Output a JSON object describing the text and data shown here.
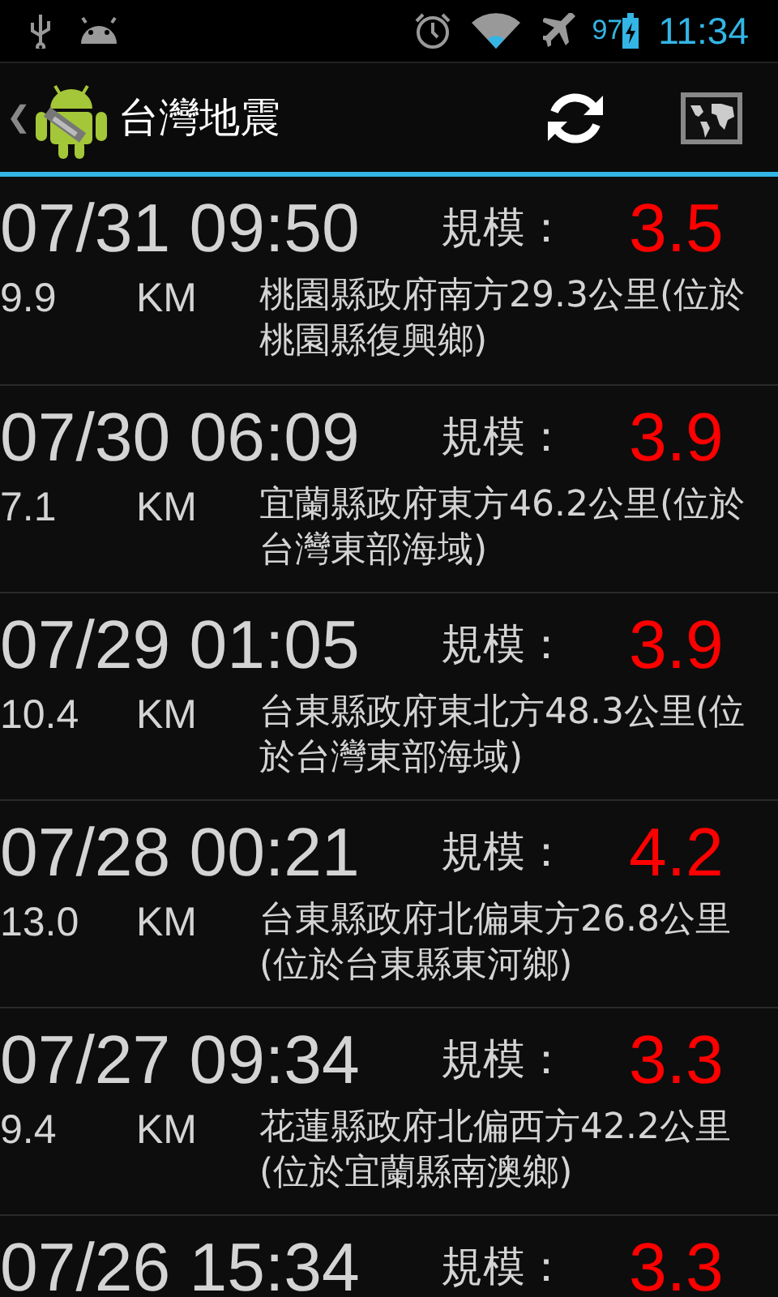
{
  "status_bar": {
    "battery_text": "97",
    "time": "11:34"
  },
  "action_bar": {
    "back": "❮",
    "title": "台灣地震"
  },
  "quakes": [
    {
      "time": "07/31 09:50",
      "magnitude_label": "規模：",
      "magnitude": "3.5",
      "depth": "9.9",
      "unit": "KM",
      "location": "桃園縣政府南方29.3公里(位於桃園縣復興鄉)"
    },
    {
      "time": "07/30 06:09",
      "magnitude_label": "規模：",
      "magnitude": "3.9",
      "depth": "7.1",
      "unit": "KM",
      "location": "宜蘭縣政府東方46.2公里(位於台灣東部海域)"
    },
    {
      "time": "07/29 01:05",
      "magnitude_label": "規模：",
      "magnitude": "3.9",
      "depth": "10.4",
      "unit": "KM",
      "location": "台東縣政府東北方48.3公里(位於台灣東部海域)"
    },
    {
      "time": "07/28 00:21",
      "magnitude_label": "規模：",
      "magnitude": "4.2",
      "depth": "13.0",
      "unit": "KM",
      "location": "台東縣政府北偏東方26.8公里(位於台東縣東河鄉)"
    },
    {
      "time": "07/27 09:34",
      "magnitude_label": "規模：",
      "magnitude": "3.3",
      "depth": "9.4",
      "unit": "KM",
      "location": "花蓮縣政府北偏西方42.2公里(位於宜蘭縣南澳鄉)"
    },
    {
      "time": "07/26 15:34",
      "magnitude_label": "規模：",
      "magnitude": "3.3"
    }
  ]
}
